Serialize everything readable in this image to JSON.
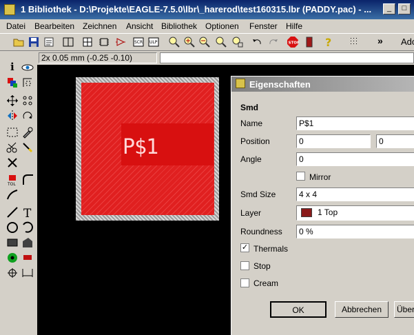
{
  "window": {
    "title": "1 Bibliothek - D:\\Projekte\\EAGLE-7.5.0\\lbr\\_harerod\\test160315.lbr (PADDY.pac) - ..."
  },
  "menu": [
    "Datei",
    "Bearbeiten",
    "Zeichnen",
    "Ansicht",
    "Bibliothek",
    "Optionen",
    "Fenster",
    "Hilfe"
  ],
  "toolbar": {
    "overflow_label": "»",
    "truncated_label": "Ado"
  },
  "coords": {
    "text": "2x 0.05 mm (-0.25 -0.10)"
  },
  "canvas": {
    "pad_name": "P$1",
    "pad_color": "#e02020"
  },
  "dialog": {
    "title": "Eigenschaften",
    "section": "Smd",
    "fields": {
      "name_label": "Name",
      "name_value": "P$1",
      "position_label": "Position",
      "position_x": "0",
      "position_y": "0",
      "angle_label": "Angle",
      "angle_value": "0",
      "mirror_label": "Mirror",
      "mirror_checked": false,
      "smd_size_label": "Smd Size",
      "smd_size_value": "4 x 4",
      "layer_label": "Layer",
      "layer_value": "1 Top",
      "layer_color": "#8a1a1a",
      "roundness_label": "Roundness",
      "roundness_value": "0 %",
      "thermals_label": "Thermals",
      "thermals_checked": true,
      "stop_label": "Stop",
      "stop_checked": false,
      "cream_label": "Cream",
      "cream_checked": false
    },
    "buttons": {
      "ok": "OK",
      "cancel": "Abbrechen",
      "apply": "Über"
    }
  }
}
